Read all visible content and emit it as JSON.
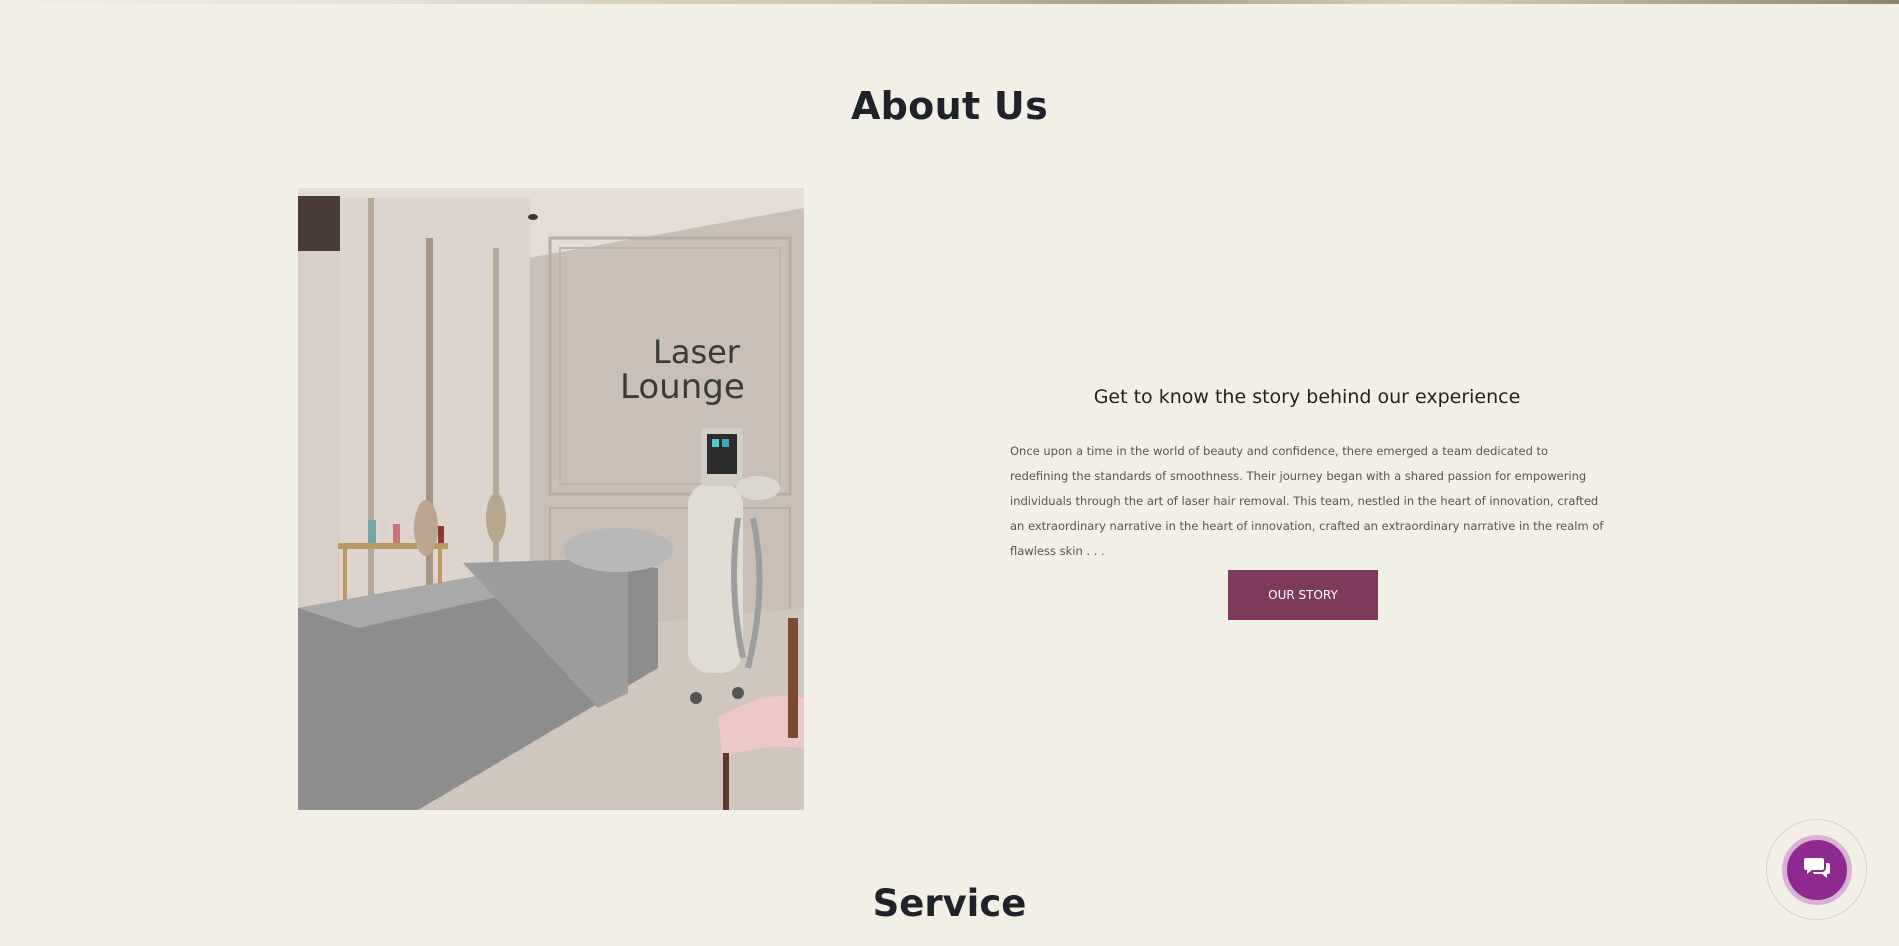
{
  "about": {
    "title": "About Us",
    "image_alt": "Laser Lounge treatment room",
    "image_logo_line1": "Laser",
    "image_logo_line2": "Lounge",
    "story_title": "Get to know the story behind our experience",
    "story_text": "Once upon a time in the world of beauty and confidence, there emerged a team dedicated to redefining the standards of smoothness. Their journey began with a shared passion for empowering individuals through the art of laser hair removal. This team, nestled in the heart of innovation, crafted an extraordinary narrative in the heart of innovation, crafted an extraordinary narrative in the realm of flawless skin . . .",
    "button_label": "OUR STORY"
  },
  "service": {
    "title": "Service"
  },
  "chat": {
    "icon": "chat-bubbles-icon"
  },
  "colors": {
    "background": "#f2efe6",
    "accent": "#7d3a5d",
    "chat": "#8e2a8f"
  }
}
